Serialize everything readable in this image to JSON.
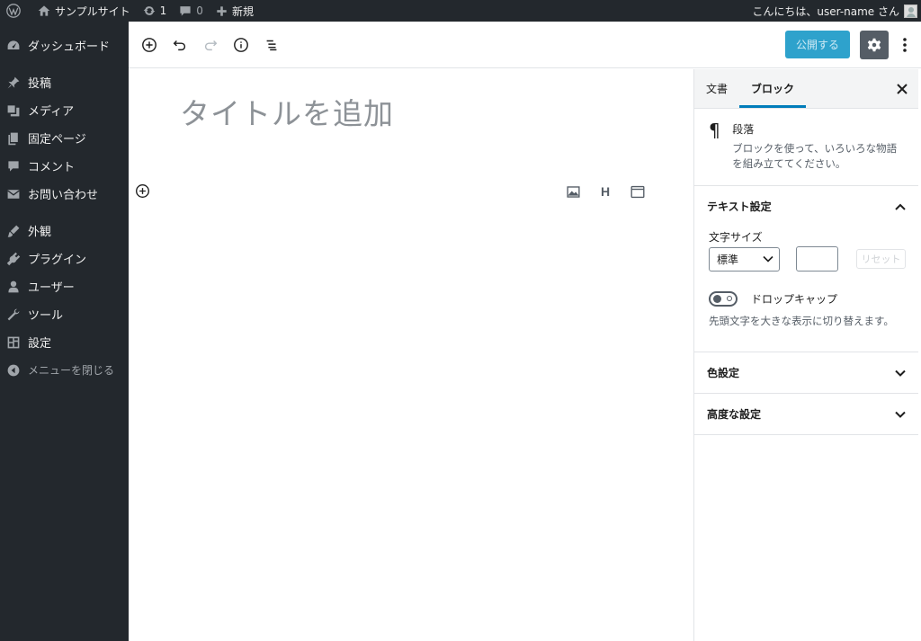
{
  "adminbar": {
    "site_name": "サンプルサイト",
    "updates_count": "1",
    "comments_count": "0",
    "new_label": "新規",
    "greeting": "こんにちは、user-name さん"
  },
  "sidebar": {
    "items": [
      {
        "label": "ダッシュボード",
        "icon": "dashboard-icon"
      },
      {
        "label": "投稿",
        "icon": "pin-icon"
      },
      {
        "label": "メディア",
        "icon": "media-icon"
      },
      {
        "label": "固定ページ",
        "icon": "page-icon"
      },
      {
        "label": "コメント",
        "icon": "comment-icon"
      },
      {
        "label": "お問い合わせ",
        "icon": "mail-icon"
      },
      {
        "label": "外観",
        "icon": "brush-icon"
      },
      {
        "label": "プラグイン",
        "icon": "plugin-icon"
      },
      {
        "label": "ユーザー",
        "icon": "user-icon"
      },
      {
        "label": "ツール",
        "icon": "wrench-icon"
      },
      {
        "label": "設定",
        "icon": "settings-icon"
      },
      {
        "label": "メニューを閉じる",
        "icon": "collapse-icon"
      }
    ]
  },
  "header": {
    "publish_label": "公開する"
  },
  "canvas": {
    "title_placeholder": "タイトルを追加"
  },
  "settings": {
    "tabs": [
      "文書",
      "ブロック"
    ],
    "active_tab": "ブロック",
    "block": {
      "icon": "paragraph-icon",
      "name": "段落",
      "description": "ブロックを使って、いろいろな物語を組み立ててください。"
    },
    "text_settings": {
      "title": "テキスト設定",
      "font_size_label": "文字サイズ",
      "font_size_value": "標準",
      "custom_size_value": "",
      "reset_label": "リセット",
      "drop_cap_label": "ドロップキャップ",
      "drop_cap_help": "先頭文字を大きな表示に切り替えます。"
    },
    "color_settings_title": "色設定",
    "advanced_title": "高度な設定"
  },
  "colors": {
    "admin_bar_bg": "#23282d",
    "accent": "#007cba",
    "publish_bg": "#2ea2cc"
  }
}
